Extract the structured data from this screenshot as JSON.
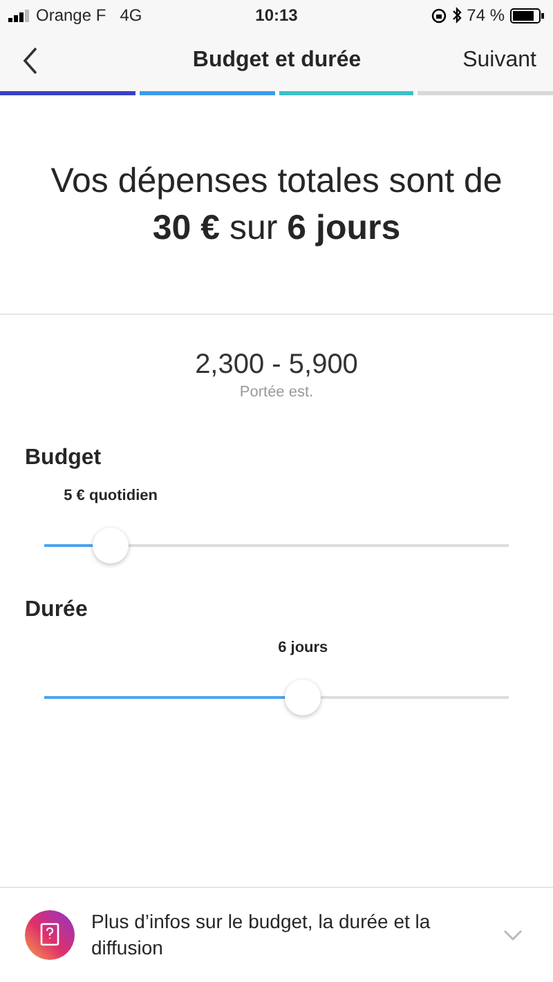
{
  "status_bar": {
    "carrier": "Orange F",
    "network": "4G",
    "time": "10:13",
    "battery": "74 %"
  },
  "nav": {
    "title": "Budget et durée",
    "next": "Suivant"
  },
  "progress": [
    {
      "color": "#3a3fc4"
    },
    {
      "color": "#3d9be9"
    },
    {
      "color": "#3cc0c8"
    },
    {
      "color": "#d8d8d8"
    }
  ],
  "headline": "Vos dépenses totales sont de **30 €** sur **6 jours**",
  "reach": {
    "value": "2,300 - 5,900",
    "label": "Portée est."
  },
  "sliders": [
    {
      "label": "Budget",
      "reading": "5 € quotidien",
      "level": 0.143
    },
    {
      "label": "Durée",
      "reading": "6 jours",
      "level": 0.557
    }
  ],
  "info": {
    "text": "Plus d’infos sur le budget, la durée et la diffusion",
    "expanded": false
  }
}
